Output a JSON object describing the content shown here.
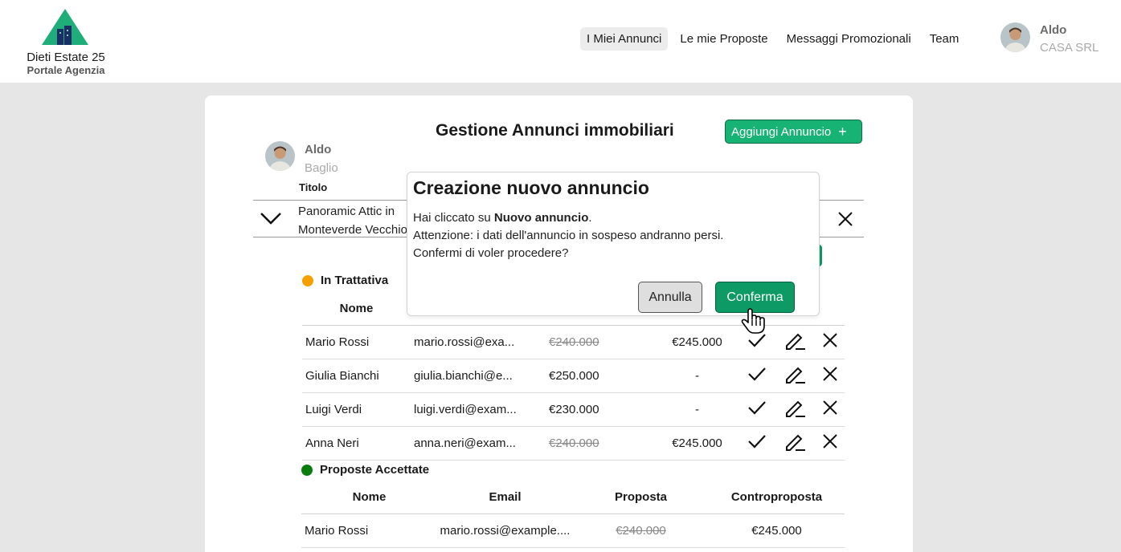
{
  "brand": {
    "name": "Dieti Estate 25",
    "subtitle": "Portale Agenzia"
  },
  "nav": {
    "items": [
      {
        "label": "I Miei Annunci",
        "active": true
      },
      {
        "label": "Le mie Proposte"
      },
      {
        "label": "Messaggi Promozionali"
      },
      {
        "label": "Team"
      }
    ]
  },
  "user": {
    "name": "Aldo",
    "company": "CASA SRL"
  },
  "page": {
    "title": "Gestione Annunci immobiliari",
    "add_button": "Aggiungi Annuncio",
    "add_icon": "plus-icon",
    "agent": {
      "name": "Aldo",
      "surname": "Baglio"
    },
    "column_title": "Titolo",
    "listing_title": "Panoramic Attic in Monteverde Vecchio"
  },
  "in_trattativa": {
    "label": "In Trattativa",
    "color": "#f5a000",
    "columns": [
      "Nome"
    ],
    "rows": [
      {
        "nome": "Mario Rossi",
        "email": "mario.rossi@exa...",
        "proposta": "€240.000",
        "struck": true,
        "controproposta": "€245.000"
      },
      {
        "nome": "Giulia Bianchi",
        "email": "giulia.bianchi@e...",
        "proposta": "€250.000",
        "struck": false,
        "controproposta": "-"
      },
      {
        "nome": "Luigi Verdi",
        "email": "luigi.verdi@exam...",
        "proposta": "€230.000",
        "struck": false,
        "controproposta": "-"
      },
      {
        "nome": "Anna Neri",
        "email": "anna.neri@exam...",
        "proposta": "€240.000",
        "struck": true,
        "controproposta": "€245.000"
      }
    ],
    "row_icons": [
      "check-icon",
      "edit-icon",
      "close-icon"
    ]
  },
  "accettate": {
    "label": "Proposte Accettate",
    "color": "#0b7d10",
    "columns": [
      "Nome",
      "Email",
      "Proposta",
      "Controproposta"
    ],
    "rows": [
      {
        "nome": "Mario Rossi",
        "email": "mario.rossi@example....",
        "proposta": "€240.000",
        "controproposta": "€245.000"
      }
    ]
  },
  "modal": {
    "title": "Creazione nuovo annuncio",
    "line1_prefix": "Hai cliccato su ",
    "line1_bold": "Nuovo annuncio",
    "line1_suffix": ".",
    "line2": "Attenzione: i dati dell'annuncio in sospeso andranno persi.",
    "line3": "Confermi di voler procedere?",
    "cancel": "Annulla",
    "confirm": "Conferma"
  },
  "colors": {
    "accent": "#17b374",
    "confirm": "#0d9a65"
  }
}
